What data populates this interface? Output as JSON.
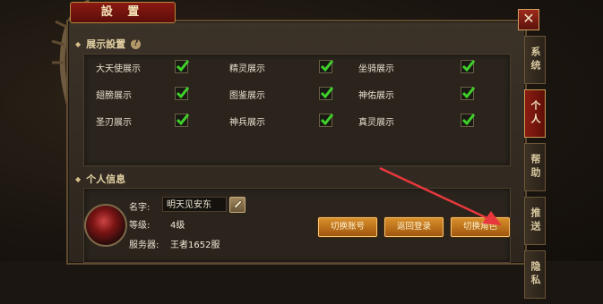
{
  "window": {
    "title": "設 置",
    "close_glyph": "✕"
  },
  "side_tabs": [
    {
      "label": "系统",
      "active": false
    },
    {
      "label": "个人",
      "active": true
    },
    {
      "label": "帮助",
      "active": false
    },
    {
      "label": "推送",
      "active": false
    },
    {
      "label": "隐私",
      "active": false
    }
  ],
  "display_settings": {
    "header": "展示設置",
    "options": [
      {
        "label": "大天使展示",
        "checked": true
      },
      {
        "label": "精灵展示",
        "checked": true
      },
      {
        "label": "坐骑展示",
        "checked": true
      },
      {
        "label": "翅膀展示",
        "checked": true
      },
      {
        "label": "图鉴展示",
        "checked": true
      },
      {
        "label": "神佑展示",
        "checked": true
      },
      {
        "label": "圣刃展示",
        "checked": true
      },
      {
        "label": "神兵展示",
        "checked": true
      },
      {
        "label": "真灵展示",
        "checked": true
      }
    ]
  },
  "personal_info": {
    "header": "个人信息",
    "name_label": "名字:",
    "name_value": "明天见安东",
    "level_label": "等级:",
    "level_value": "4级",
    "server_label": "服务器:",
    "server_value": "王者1652服"
  },
  "buttons": {
    "switch_account": "切换账号",
    "return_login": "返回登录",
    "switch_character": "切换角色"
  },
  "colors": {
    "accent_red": "#8a1a12",
    "button_orange": "#d98f2a",
    "check_green": "#3fd02a",
    "annotation_arrow": "#e8383d"
  }
}
